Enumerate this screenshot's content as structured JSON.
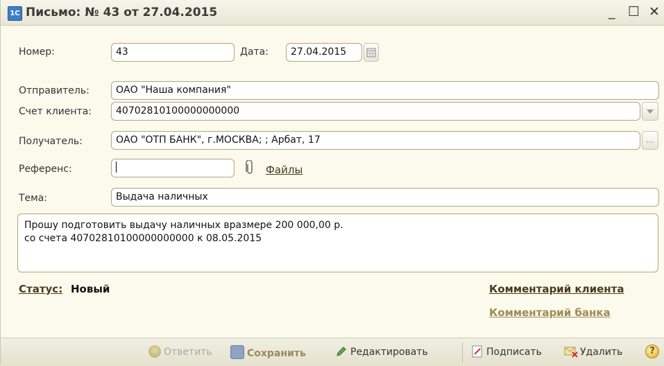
{
  "window": {
    "title": "Письмо: № 43 от 27.04.2015",
    "app_icon": "1C",
    "minimize": "_",
    "maximize": "☐",
    "close": "✕"
  },
  "form": {
    "number_label": "Номер:",
    "number_value": "43",
    "date_label": "Дата:",
    "date_value": "27.04.2015",
    "sender_label": "Отправитель:",
    "sender_value": "ОАО \"Наша компания\"",
    "account_label": "Счет клиента:",
    "account_value": "40702810100000000000",
    "recipient_label": "Получатель:",
    "recipient_value": "ОАО \"ОТП БАНК\", г.МОСКВА; ; Арбат, 17",
    "reference_label": "Референс:",
    "reference_value": "",
    "files_link": "Файлы",
    "subject_label": "Тема:",
    "subject_value": "Выдача наличных",
    "body_line1": "Прошу подготовить выдачу наличных вразмере 200 000,00 р.",
    "body_line2": "со счета 40702810100000000000 к 08.05.2015"
  },
  "status": {
    "label": "Статус:",
    "value": "Новый",
    "client_comment": "Комментарий клиента",
    "bank_comment": "Комментарий банка"
  },
  "toolbar": {
    "reply": "Ответить",
    "save": "Сохранить",
    "edit": "Редактировать",
    "sign": "Подписать",
    "delete": "Удалить",
    "help": "?"
  },
  "colors": {
    "field_border": "#b5a47a",
    "link_dark": "#4a3a1a",
    "link_muted": "#a08a55",
    "background": "#fbfaed"
  }
}
